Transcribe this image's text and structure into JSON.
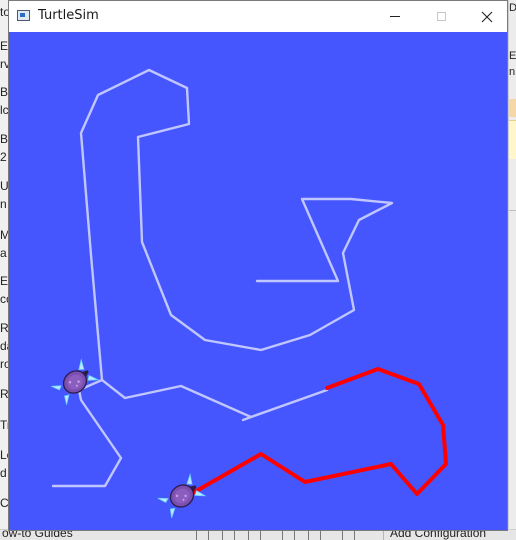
{
  "window": {
    "title": "TurtleSim",
    "icon": "window-app-icon",
    "controls": {
      "minimize": "minimize-icon",
      "maximize": "maximize-icon",
      "close": "close-icon"
    }
  },
  "canvas": {
    "background": "#4556ff",
    "trails": [
      {
        "name": "white-trail",
        "color": "#c0c6ff"
      },
      {
        "name": "red-trail",
        "color": "#ff0000"
      }
    ],
    "turtles": [
      {
        "name": "turtle-1",
        "icon": "turtle-icon"
      },
      {
        "name": "turtle-2",
        "icon": "turtle-icon"
      }
    ]
  },
  "background_ide": {
    "bottom_left_text": "ow-to Guides",
    "bottom_right_text": "Add Configuration"
  }
}
